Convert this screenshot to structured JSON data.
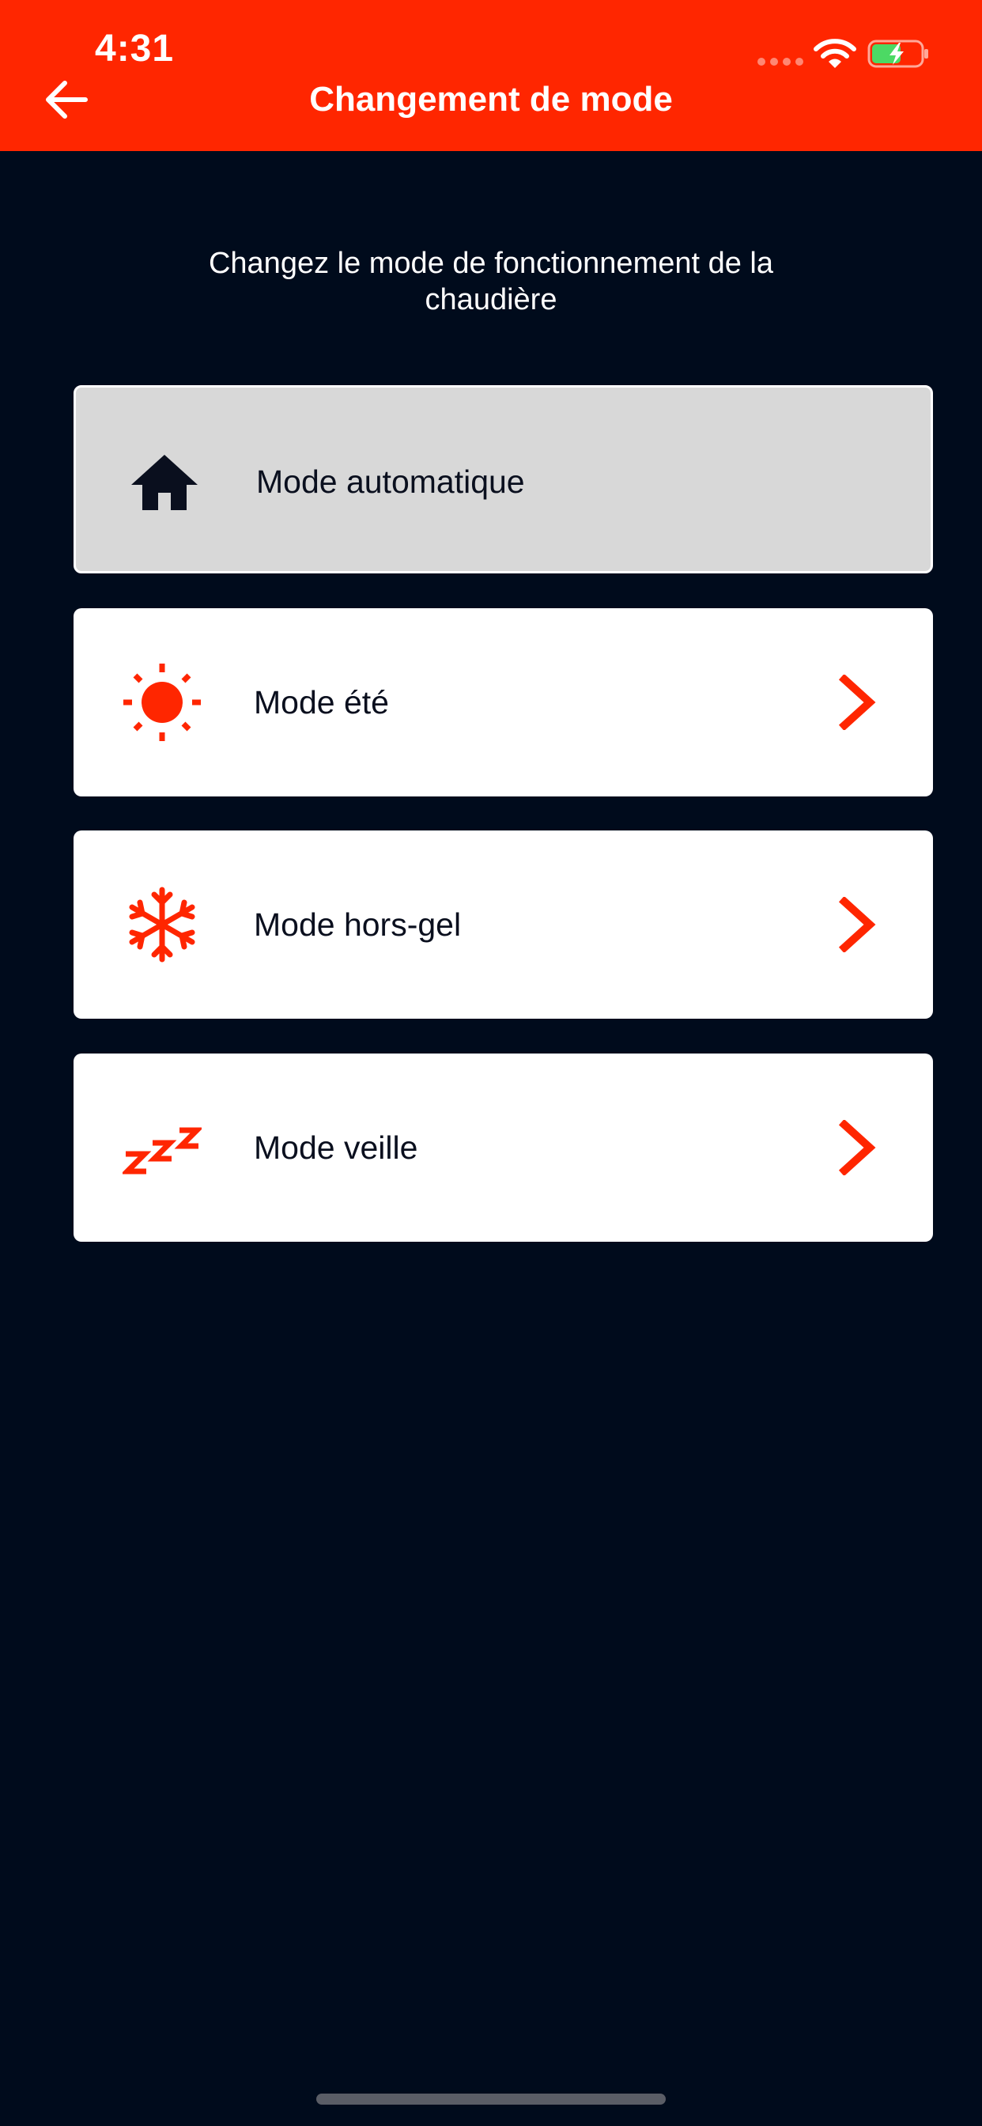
{
  "status_bar": {
    "time": "4:31"
  },
  "header": {
    "title": "Changement de mode",
    "background_color": "#ff2600"
  },
  "intro": {
    "text": "Changez le mode de fonctionnement de la chaudière"
  },
  "modes": [
    {
      "label": "Mode automatique",
      "icon": "home-icon",
      "selected": true
    },
    {
      "label": "Mode été",
      "icon": "sun-icon",
      "selected": false
    },
    {
      "label": "Mode hors-gel",
      "icon": "snowflake-icon",
      "selected": false
    },
    {
      "label": "Mode veille",
      "icon": "sleep-zzz-icon",
      "selected": false
    }
  ],
  "colors": {
    "accent": "#ff2600",
    "page_background": "#000b1c",
    "selected_card": "#d8d8d8",
    "card": "#ffffff"
  }
}
